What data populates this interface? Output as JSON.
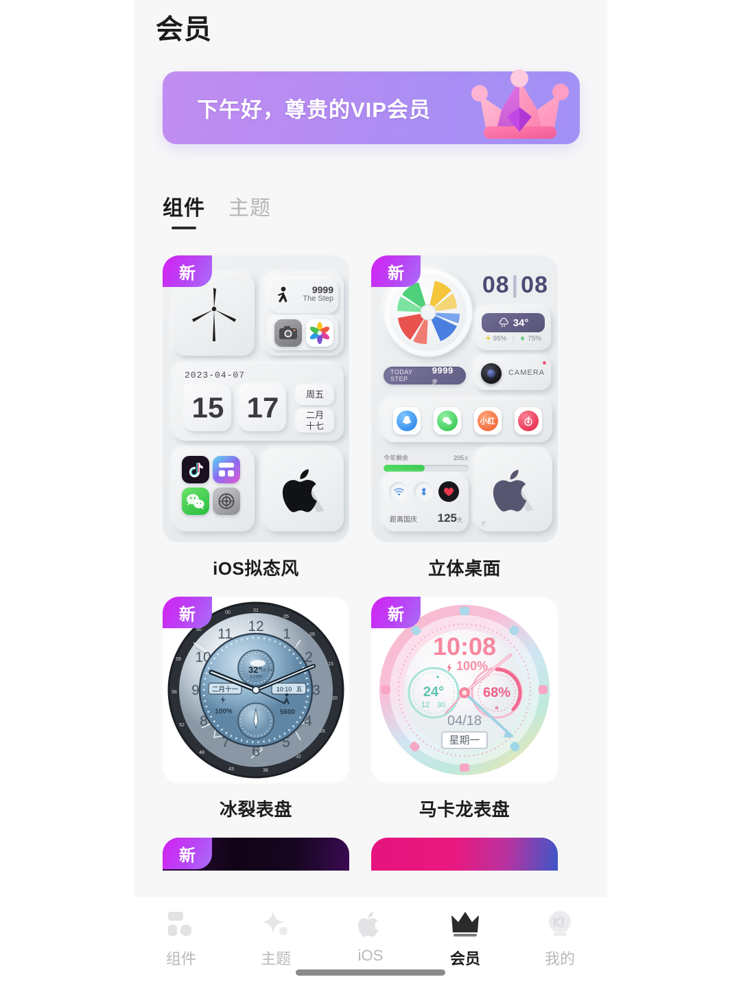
{
  "header": {
    "title": "会员"
  },
  "banner": {
    "greeting": "下午好，尊贵的VIP会员",
    "icon": "crown-3d-icon",
    "gradient_from": "#c18df0",
    "gradient_to": "#a291f5"
  },
  "tabs": [
    {
      "label": "组件",
      "active": true
    },
    {
      "label": "主题",
      "active": false
    }
  ],
  "badge": {
    "label": "新",
    "color_from": "#d322f2",
    "color_to": "#a96ff8"
  },
  "cards": [
    {
      "title": "iOS拟态风",
      "badge": "新",
      "type": "widget-board",
      "widgets": {
        "turbine": "wind-turbine-icon",
        "step_count": "9999",
        "step_label": "The Step",
        "apps_top": [
          "camera-icon",
          "photos-icon"
        ],
        "date_full": "2023-04-07",
        "hour": "15",
        "minute": "17",
        "weekday": "周五",
        "lunar_month": "二月",
        "lunar_day": "十七",
        "apps_bottom": [
          "tiktok-icon",
          "widget-icon",
          "wechat-icon",
          "settings-icon"
        ],
        "apple": "apple-logo-icon"
      }
    },
    {
      "title": "立体桌面",
      "badge": "新",
      "type": "widget-board",
      "widgets": {
        "pinwheel": "color-pinwheel-icon",
        "time_hour": "08",
        "time_minute": "08",
        "weather_icon": "cloud-rain-icon",
        "temperature": "34°",
        "humidity": "95%",
        "air": "75%",
        "camera_label": "CAMERA",
        "step_label": "TODAY STEP",
        "step_count": "9999",
        "step_unit": "步",
        "dock": [
          "qq-icon",
          "wechat-icon",
          "xiaohongshu-icon",
          "netease-music-icon"
        ],
        "progress_label": "今年剩余",
        "progress_value": "205",
        "progress_unit": "天",
        "progress_percent": 48,
        "control_icons": [
          "wifi-icon",
          "bluetooth-icon",
          "heart-icon"
        ],
        "countdown_label": "距离国庆",
        "countdown_value": "125",
        "countdown_unit": "天",
        "apple": "apple-logo-icon"
      }
    },
    {
      "title": "冰裂表盘",
      "badge": "新",
      "type": "watch-face",
      "watch": {
        "style": "ice-crack",
        "temperature": "32°",
        "temp_range": "19~26°",
        "lunar_date": "二月十一",
        "time": "10:10",
        "weekday": "五",
        "battery": "100%",
        "steps": "5600",
        "hour_numerals": [
          "12",
          "1",
          "2",
          "3",
          "4",
          "5",
          "6",
          "7",
          "8",
          "9",
          "10",
          "11"
        ]
      }
    },
    {
      "title": "马卡龙表盘",
      "badge": "新",
      "type": "watch-face",
      "watch": {
        "style": "macaron",
        "time": "10:08",
        "battery": "100%",
        "temperature": "24°",
        "temp_range_low": "12",
        "temp_range_high": "30",
        "ring_percent": "68%",
        "date": "04/18",
        "weekday": "星期一"
      }
    },
    {
      "title": "",
      "badge": "新",
      "type": "clip-dark"
    },
    {
      "title": "",
      "badge": "",
      "type": "clip-pink"
    }
  ],
  "bottom_nav": [
    {
      "label": "组件",
      "icon": "widgets-icon",
      "active": false
    },
    {
      "label": "主题",
      "icon": "sparkle-icon",
      "active": false
    },
    {
      "label": "iOS",
      "icon": "apple-logo-icon",
      "active": false
    },
    {
      "label": "会员",
      "icon": "crown-icon",
      "active": true
    },
    {
      "label": "我的",
      "icon": "profile-icon",
      "active": false
    }
  ]
}
